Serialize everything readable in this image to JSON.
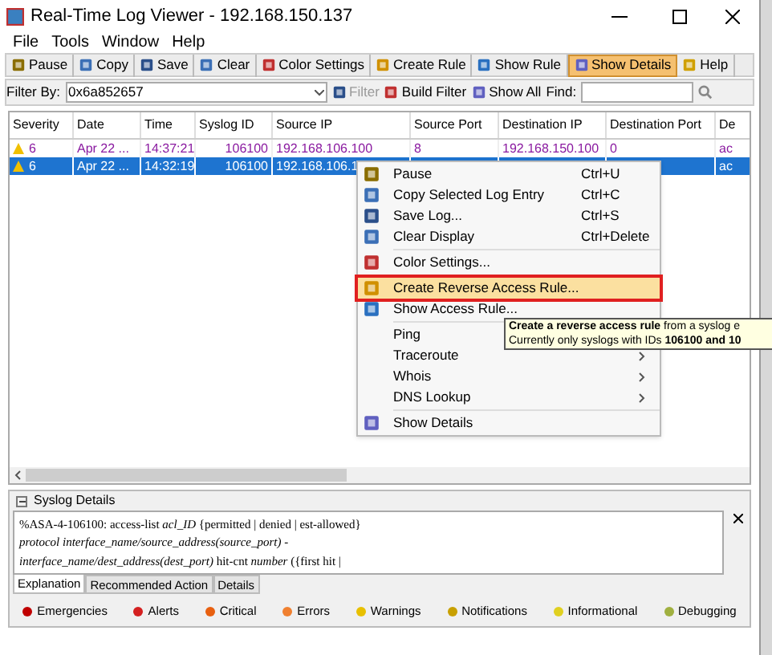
{
  "window": {
    "title": "Real-Time Log Viewer - 192.168.150.137"
  },
  "menu_bar": [
    "File",
    "Tools",
    "Window",
    "Help"
  ],
  "toolbar": [
    {
      "label": "Pause",
      "selected": false
    },
    {
      "label": "Copy",
      "selected": false
    },
    {
      "label": "Save",
      "selected": false
    },
    {
      "label": "Clear",
      "selected": false
    },
    {
      "label": "Color Settings",
      "selected": false
    },
    {
      "label": "Create Rule",
      "selected": false
    },
    {
      "label": "Show Rule",
      "selected": false
    },
    {
      "label": "Show Details",
      "selected": true
    },
    {
      "label": "Help",
      "selected": false
    }
  ],
  "filter_bar": {
    "label": "Filter By:",
    "value": "0x6a852657",
    "filter": "Filter",
    "build_filter": "Build Filter",
    "show_all": "Show All",
    "find_label": "Find:"
  },
  "table": {
    "columns": [
      "Severity",
      "Date",
      "Time",
      "Syslog ID",
      "Source IP",
      "Source Port",
      "Destination IP",
      "Destination Port",
      "De"
    ],
    "rows": [
      {
        "selected": false,
        "cells": [
          "6",
          "Apr 22 ...",
          "14:37:21",
          "106100",
          "192.168.106.100",
          "8",
          "192.168.150.100",
          "0",
          "ac"
        ]
      },
      {
        "selected": true,
        "cells": [
          "6",
          "Apr 22 ...",
          "14:32:19",
          "106100",
          "192.168.106.1",
          "",
          "",
          "",
          "ac"
        ]
      }
    ]
  },
  "context_menu": [
    {
      "kind": "item",
      "label": "Pause",
      "shortcut": "Ctrl+U",
      "highlighted": false
    },
    {
      "kind": "item",
      "label": "Copy Selected Log Entry",
      "shortcut": "Ctrl+C",
      "highlighted": false
    },
    {
      "kind": "item",
      "label": "Save Log...",
      "shortcut": "Ctrl+S",
      "highlighted": false
    },
    {
      "kind": "item",
      "label": "Clear Display",
      "shortcut": "Ctrl+Delete",
      "highlighted": false
    },
    {
      "kind": "separator"
    },
    {
      "kind": "item",
      "label": "Color Settings...",
      "highlighted": false
    },
    {
      "kind": "separator"
    },
    {
      "kind": "item",
      "label": "Create Reverse Access Rule...",
      "highlighted": true
    },
    {
      "kind": "item",
      "label": "Show Access Rule...",
      "highlighted": false
    },
    {
      "kind": "separator"
    },
    {
      "kind": "item",
      "label": "Ping",
      "highlighted": false
    },
    {
      "kind": "item",
      "label": "Traceroute",
      "submenu": true,
      "highlighted": false
    },
    {
      "kind": "item",
      "label": "Whois",
      "submenu": true,
      "highlighted": false
    },
    {
      "kind": "item",
      "label": "DNS Lookup",
      "submenu": true,
      "highlighted": false
    },
    {
      "kind": "separator"
    },
    {
      "kind": "item",
      "label": "Show Details",
      "highlighted": false
    }
  ],
  "tooltip": [
    "**Create a reverse access rule** from a syslog e",
    "Currently only syslogs with IDs **106100 and 10**"
  ],
  "syslog_details": {
    "title": "Syslog Details",
    "lines": [
      "%ASA-4-106100: access-list *acl_ID* {permitted | denied | est-allowed}",
      "*protocol interface_name/source_address(source_port)* -",
      "*interface_name/dest_address(dest_port)* hit-cnt *number* ({first  hit |"
    ],
    "tabs": [
      {
        "label": "Explanation",
        "selected": true
      },
      {
        "label": "Recommended Action",
        "selected": false
      },
      {
        "label": "Details",
        "selected": false
      }
    ]
  },
  "legend": [
    {
      "label": "Emergencies",
      "color": "#c00000"
    },
    {
      "label": "Alerts",
      "color": "#d42020"
    },
    {
      "label": "Critical",
      "color": "#e86010"
    },
    {
      "label": "Errors",
      "color": "#f08030"
    },
    {
      "label": "Warnings",
      "color": "#e8c000"
    },
    {
      "label": "Notifications",
      "color": "#c8a000"
    },
    {
      "label": "Informational",
      "color": "#e0d020"
    },
    {
      "label": "Debugging",
      "color": "#a0b040"
    }
  ]
}
